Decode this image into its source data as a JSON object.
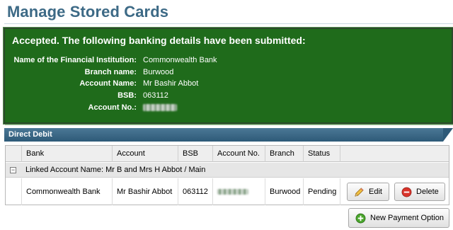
{
  "page": {
    "title": "Manage Stored Cards"
  },
  "banner": {
    "heading": "Accepted. The following banking details have been submitted:",
    "fields": [
      {
        "label": "Name of the Financial Institution:",
        "value": "Commonwealth Bank"
      },
      {
        "label": "Branch name:",
        "value": "Burwood"
      },
      {
        "label": "Account Name:",
        "value": "Mr Bashir Abbot"
      },
      {
        "label": "BSB:",
        "value": "063112"
      },
      {
        "label": "Account No.:",
        "value": ""
      }
    ]
  },
  "direct_debit": {
    "header": "Direct Debit",
    "columns": [
      "Bank",
      "Account",
      "BSB",
      "Account No.",
      "Branch",
      "Status"
    ],
    "group_label": "Linked Account Name: Mr B and Mrs H Abbot / Main",
    "row": {
      "bank": "Commonwealth Bank",
      "account": "Mr Bashir Abbot",
      "bsb": "063112",
      "account_no": "",
      "branch": "Burwood",
      "status": "Pending"
    },
    "edit_label": "Edit",
    "delete_label": "Delete"
  },
  "new_payment_label": "New Payment Option",
  "icons": {
    "edit": "pencil-icon",
    "delete": "delete-circle-icon",
    "add": "add-circle-icon",
    "collapse": "collapse-minus-icon"
  },
  "colors": {
    "title": "#3d6a86",
    "banner_bg": "#1f6b1b",
    "panel_header": "#3a6888"
  }
}
